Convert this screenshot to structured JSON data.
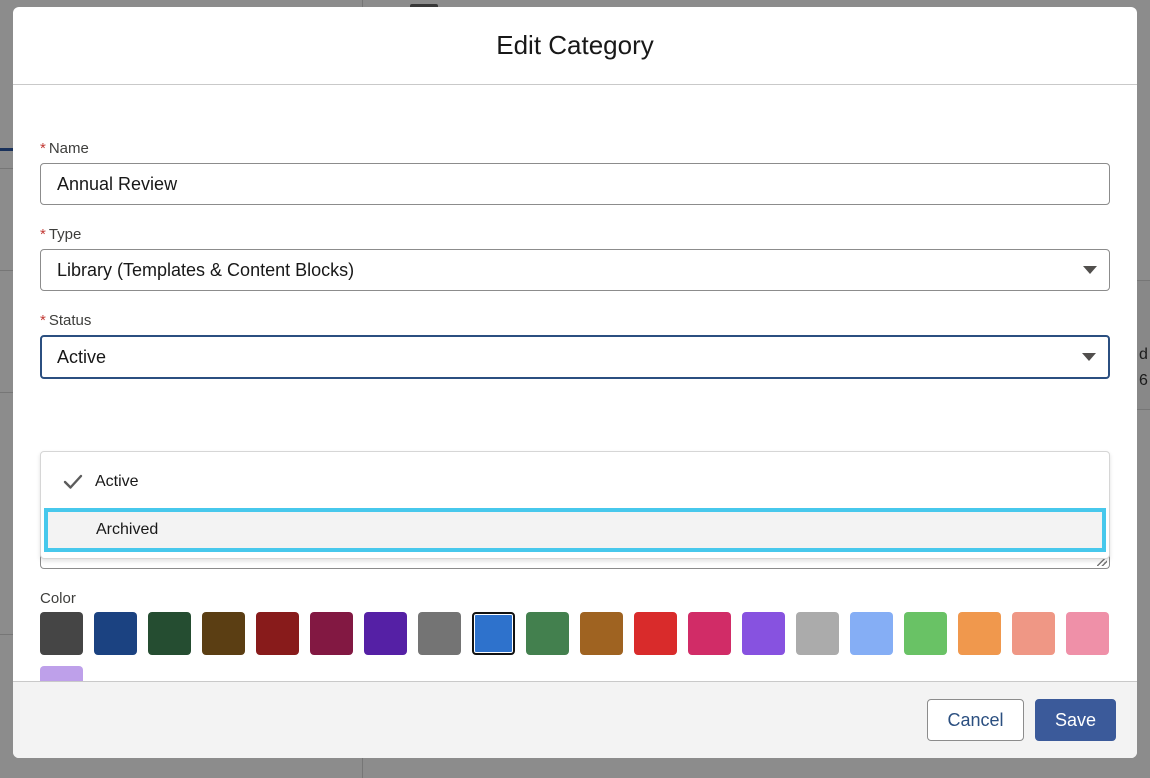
{
  "modal": {
    "title": "Edit Category"
  },
  "form": {
    "name": {
      "label": "Name",
      "required_mark": "*",
      "value": "Annual Review"
    },
    "type": {
      "label": "Type",
      "required_mark": "*",
      "value": "Library (Templates & Content Blocks)"
    },
    "status": {
      "label": "Status",
      "required_mark": "*",
      "value": "Active",
      "options": [
        {
          "label": "Active",
          "checked": true
        },
        {
          "label": "Archived",
          "checked": false,
          "hovered": true
        }
      ]
    },
    "color": {
      "label": "Color",
      "selected_index": 8,
      "swatches": [
        "#454545",
        "#1b4281",
        "#254d31",
        "#5b3e13",
        "#881b1b",
        "#821842",
        "#5520a5",
        "#747474",
        "#2e72cc",
        "#43804e",
        "#9f6321",
        "#d92b2b",
        "#d12c67",
        "#8752e0",
        "#ababab",
        "#85aef5",
        "#69c265",
        "#f0984d",
        "#ef9785",
        "#ef90a8",
        "#bea0ea"
      ]
    }
  },
  "footer": {
    "cancel_label": "Cancel",
    "save_label": "Save"
  },
  "background": {
    "right_text_1": "d",
    "right_text_2": "6"
  }
}
